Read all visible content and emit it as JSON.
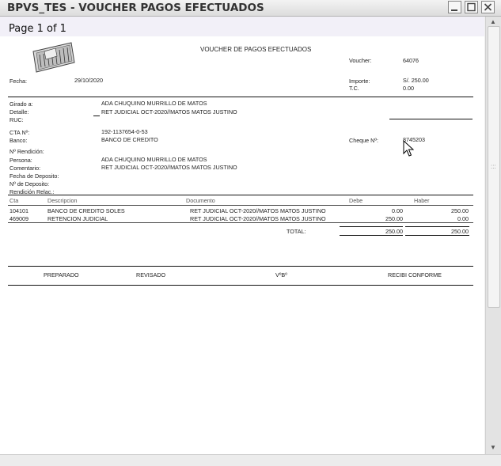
{
  "window": {
    "title": "BPVS_TES - VOUCHER PAGOS EFECTUADOS"
  },
  "toolbar": {
    "page_info": "Page 1 of 1"
  },
  "report": {
    "title": "VOUCHER DE PAGOS EFECTUADOS",
    "voucher_label": "Voucher:",
    "voucher_value": "64076",
    "fecha_label": "Fecha:",
    "fecha_value": "29/10/2020",
    "importe_label": "Importe:",
    "importe_value": "S/. 250.00",
    "tc_label": "T.C.",
    "tc_value": "0.00",
    "girado_label": "Girado a:",
    "girado_value": "ADA CHUQUINO MURRILLO DE MATOS",
    "detalle_label": "Detalle:",
    "detalle_value": "RET JUDICIAL OCT-2020//MATOS MATOS  JUSTINO",
    "ruc_label": "RUC:",
    "cta_label": "CTA Nº:",
    "cta_value": "192-1137654-0-53",
    "banco_label": "Banco:",
    "banco_value": "BANCO DE CREDITO",
    "cheque_label": "Cheque Nº:",
    "cheque_value": "8745203",
    "rendicion_label": "Nº Rendición:",
    "persona_label": "Persona:",
    "persona_value": "ADA CHUQUINO MURRILLO DE MATOS",
    "comentario_label": "Comentario:",
    "comentario_value": "RET JUDICIAL OCT-2020//MATOS MATOS  JUSTINO",
    "fecha_deposito_label": "Fecha de Deposito:",
    "num_deposito_label": "Nº de Deposito:",
    "rendicion_relac_label": "Rendición Relac.:",
    "columns": {
      "cta": "Cta",
      "descripcion": "Descripcion",
      "documento": "Documento",
      "debe": "Debe",
      "haber": "Haber"
    },
    "rows": [
      {
        "cta": "104101",
        "descripcion": "BANCO DE CREDITO SOLES",
        "documento": "RET JUDICIAL OCT-2020//MATOS MATOS  JUSTINO",
        "debe": "0.00",
        "haber": "250.00"
      },
      {
        "cta": "469009",
        "descripcion": "RETENCION JUDICIAL",
        "documento": "RET JUDICIAL OCT-2020//MATOS MATOS  JUSTINO",
        "debe": "250.00",
        "haber": "0.00"
      }
    ],
    "total_label": "TOTAL:",
    "total_debe": "250.00",
    "total_haber": "250.00",
    "signatures": {
      "preparado": "PREPARADO",
      "revisado": "REVISADO",
      "vobo": "VºBº",
      "recibi": "RECIBI CONFORME"
    }
  }
}
